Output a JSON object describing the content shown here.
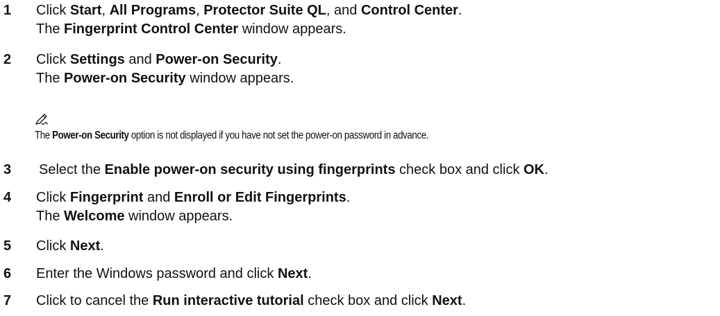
{
  "steps": [
    {
      "number": "1",
      "line1": [
        {
          "t": "Click "
        },
        {
          "t": "Start",
          "b": true
        },
        {
          "t": ", "
        },
        {
          "t": "All Programs",
          "b": true
        },
        {
          "t": ", "
        },
        {
          "t": "Protector Suite QL",
          "b": true
        },
        {
          "t": ", and "
        },
        {
          "t": "Control Center",
          "b": true
        },
        {
          "t": "."
        }
      ],
      "line2": [
        {
          "t": "The "
        },
        {
          "t": "Fingerprint Control Center",
          "b": true
        },
        {
          "t": " window appears."
        }
      ]
    },
    {
      "number": "2",
      "line1": [
        {
          "t": "Click "
        },
        {
          "t": "Settings",
          "b": true
        },
        {
          "t": " and "
        },
        {
          "t": "Power-on Security",
          "b": true
        },
        {
          "t": "."
        }
      ],
      "line2": [
        {
          "t": "The "
        },
        {
          "t": "Power-on Security",
          "b": true
        },
        {
          "t": " window appears."
        }
      ]
    },
    {
      "number": "3",
      "line1": [
        {
          "t": "Select the "
        },
        {
          "t": "Enable power-on security using fingerprints",
          "b": true
        },
        {
          "t": " check box and click "
        },
        {
          "t": "OK",
          "b": true
        },
        {
          "t": "."
        }
      ]
    },
    {
      "number": "4",
      "line1": [
        {
          "t": "Click "
        },
        {
          "t": "Fingerprint",
          "b": true
        },
        {
          "t": " and "
        },
        {
          "t": "Enroll or Edit Fingerprints",
          "b": true
        },
        {
          "t": "."
        }
      ],
      "line2": [
        {
          "t": "The "
        },
        {
          "t": "Welcome",
          "b": true
        },
        {
          "t": " window appears."
        }
      ]
    },
    {
      "number": "5",
      "line1": [
        {
          "t": "Click "
        },
        {
          "t": "Next",
          "b": true
        },
        {
          "t": "."
        }
      ]
    },
    {
      "number": "6",
      "line1": [
        {
          "t": "Enter the Windows password and click "
        },
        {
          "t": "Next",
          "b": true
        },
        {
          "t": "."
        }
      ]
    },
    {
      "number": "7",
      "line1": [
        {
          "t": "Click to cancel the "
        },
        {
          "t": "Run interactive tutorial",
          "b": true
        },
        {
          "t": " check box and click "
        },
        {
          "t": "Next",
          "b": true
        },
        {
          "t": "."
        }
      ]
    }
  ],
  "note": {
    "icon": "pencil-note-icon",
    "parts": [
      {
        "t": "The "
      },
      {
        "t": "Power-on Security",
        "b": true
      },
      {
        "t": " option is not displayed if you have not set the power-on password in advance."
      }
    ]
  }
}
